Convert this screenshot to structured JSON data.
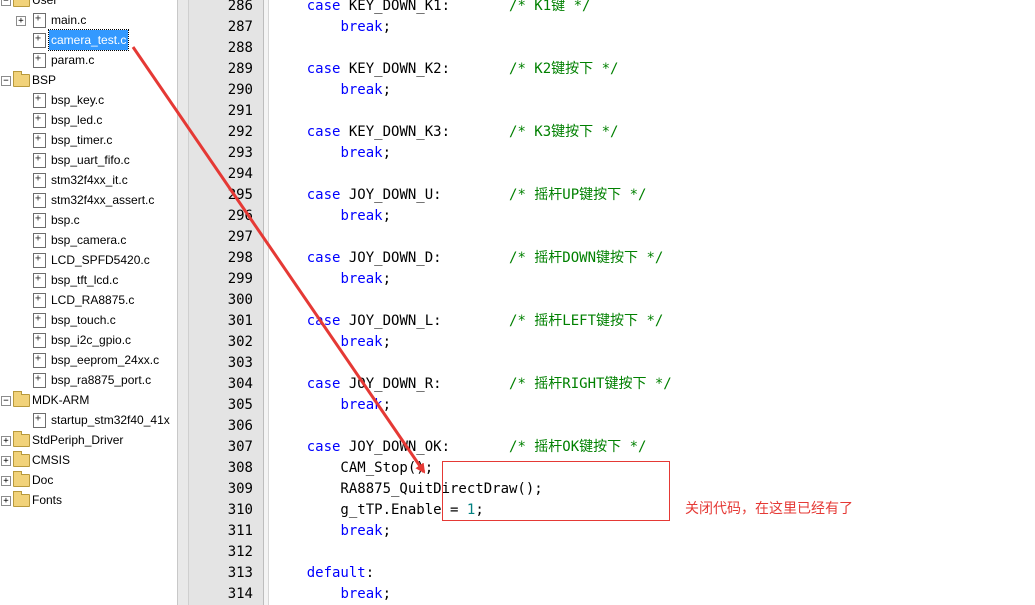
{
  "tree": {
    "items": [
      {
        "label": "User",
        "type": "folder",
        "depth": 0,
        "expander": "-"
      },
      {
        "label": "main.c",
        "type": "file",
        "depth": 1,
        "expander": "+"
      },
      {
        "label": "camera_test.c",
        "type": "file",
        "depth": 1,
        "expander": "",
        "selected": true
      },
      {
        "label": "param.c",
        "type": "file",
        "depth": 1,
        "expander": ""
      },
      {
        "label": "BSP",
        "type": "folder",
        "depth": 0,
        "expander": "-"
      },
      {
        "label": "bsp_key.c",
        "type": "file",
        "depth": 1,
        "expander": ""
      },
      {
        "label": "bsp_led.c",
        "type": "file",
        "depth": 1,
        "expander": ""
      },
      {
        "label": "bsp_timer.c",
        "type": "file",
        "depth": 1,
        "expander": ""
      },
      {
        "label": "bsp_uart_fifo.c",
        "type": "file",
        "depth": 1,
        "expander": ""
      },
      {
        "label": "stm32f4xx_it.c",
        "type": "file",
        "depth": 1,
        "expander": ""
      },
      {
        "label": "stm32f4xx_assert.c",
        "type": "file",
        "depth": 1,
        "expander": ""
      },
      {
        "label": "bsp.c",
        "type": "file",
        "depth": 1,
        "expander": ""
      },
      {
        "label": "bsp_camera.c",
        "type": "file",
        "depth": 1,
        "expander": ""
      },
      {
        "label": "LCD_SPFD5420.c",
        "type": "file",
        "depth": 1,
        "expander": ""
      },
      {
        "label": "bsp_tft_lcd.c",
        "type": "file",
        "depth": 1,
        "expander": ""
      },
      {
        "label": "LCD_RA8875.c",
        "type": "file",
        "depth": 1,
        "expander": ""
      },
      {
        "label": "bsp_touch.c",
        "type": "file",
        "depth": 1,
        "expander": ""
      },
      {
        "label": "bsp_i2c_gpio.c",
        "type": "file",
        "depth": 1,
        "expander": ""
      },
      {
        "label": "bsp_eeprom_24xx.c",
        "type": "file",
        "depth": 1,
        "expander": ""
      },
      {
        "label": "bsp_ra8875_port.c",
        "type": "file",
        "depth": 1,
        "expander": ""
      },
      {
        "label": "MDK-ARM",
        "type": "folder",
        "depth": 0,
        "expander": "-"
      },
      {
        "label": "startup_stm32f40_41x",
        "type": "file",
        "depth": 1,
        "expander": ""
      },
      {
        "label": "StdPeriph_Driver",
        "type": "folder",
        "depth": 0,
        "expander": "+"
      },
      {
        "label": "CMSIS",
        "type": "folder",
        "depth": 0,
        "expander": "+"
      },
      {
        "label": "Doc",
        "type": "folder",
        "depth": 0,
        "expander": "+"
      },
      {
        "label": "Fonts",
        "type": "folder",
        "depth": 0,
        "expander": "+"
      }
    ]
  },
  "editor": {
    "lines": [
      {
        "n": "286",
        "parts": [
          {
            "t": "    "
          },
          {
            "t": "case",
            "c": "kw"
          },
          {
            "t": " KEY_DOWN_K1:       "
          },
          {
            "t": "/* K1键 */",
            "c": "cm"
          }
        ]
      },
      {
        "n": "287",
        "parts": [
          {
            "t": "        "
          },
          {
            "t": "break",
            "c": "kw"
          },
          {
            "t": ";"
          }
        ]
      },
      {
        "n": "288",
        "parts": []
      },
      {
        "n": "289",
        "parts": [
          {
            "t": "    "
          },
          {
            "t": "case",
            "c": "kw"
          },
          {
            "t": " KEY_DOWN_K2:       "
          },
          {
            "t": "/* K2键按下 */",
            "c": "cm"
          }
        ]
      },
      {
        "n": "290",
        "parts": [
          {
            "t": "        "
          },
          {
            "t": "break",
            "c": "kw"
          },
          {
            "t": ";"
          }
        ]
      },
      {
        "n": "291",
        "parts": []
      },
      {
        "n": "292",
        "parts": [
          {
            "t": "    "
          },
          {
            "t": "case",
            "c": "kw"
          },
          {
            "t": " KEY_DOWN_K3:       "
          },
          {
            "t": "/* K3键按下 */",
            "c": "cm"
          }
        ]
      },
      {
        "n": "293",
        "parts": [
          {
            "t": "        "
          },
          {
            "t": "break",
            "c": "kw"
          },
          {
            "t": ";"
          }
        ]
      },
      {
        "n": "294",
        "parts": []
      },
      {
        "n": "295",
        "parts": [
          {
            "t": "    "
          },
          {
            "t": "case",
            "c": "kw"
          },
          {
            "t": " JOY_DOWN_U:        "
          },
          {
            "t": "/* 摇杆UP键按下 */",
            "c": "cm"
          }
        ]
      },
      {
        "n": "296",
        "parts": [
          {
            "t": "        "
          },
          {
            "t": "break",
            "c": "kw"
          },
          {
            "t": ";"
          }
        ]
      },
      {
        "n": "297",
        "parts": []
      },
      {
        "n": "298",
        "parts": [
          {
            "t": "    "
          },
          {
            "t": "case",
            "c": "kw"
          },
          {
            "t": " JOY_DOWN_D:        "
          },
          {
            "t": "/* 摇杆DOWN键按下 */",
            "c": "cm"
          }
        ]
      },
      {
        "n": "299",
        "parts": [
          {
            "t": "        "
          },
          {
            "t": "break",
            "c": "kw"
          },
          {
            "t": ";"
          }
        ]
      },
      {
        "n": "300",
        "parts": []
      },
      {
        "n": "301",
        "parts": [
          {
            "t": "    "
          },
          {
            "t": "case",
            "c": "kw"
          },
          {
            "t": " JOY_DOWN_L:        "
          },
          {
            "t": "/* 摇杆LEFT键按下 */",
            "c": "cm"
          }
        ]
      },
      {
        "n": "302",
        "parts": [
          {
            "t": "        "
          },
          {
            "t": "break",
            "c": "kw"
          },
          {
            "t": ";"
          }
        ]
      },
      {
        "n": "303",
        "parts": []
      },
      {
        "n": "304",
        "parts": [
          {
            "t": "    "
          },
          {
            "t": "case",
            "c": "kw"
          },
          {
            "t": " JOY_DOWN_R:        "
          },
          {
            "t": "/* 摇杆RIGHT键按下 */",
            "c": "cm"
          }
        ]
      },
      {
        "n": "305",
        "parts": [
          {
            "t": "        "
          },
          {
            "t": "break",
            "c": "kw"
          },
          {
            "t": ";"
          }
        ]
      },
      {
        "n": "306",
        "parts": []
      },
      {
        "n": "307",
        "parts": [
          {
            "t": "    "
          },
          {
            "t": "case",
            "c": "kw"
          },
          {
            "t": " JOY_DOWN_OK:       "
          },
          {
            "t": "/* 摇杆OK键按下 */",
            "c": "cm"
          }
        ]
      },
      {
        "n": "308",
        "parts": [
          {
            "t": "        CAM_Stop();"
          }
        ]
      },
      {
        "n": "309",
        "parts": [
          {
            "t": "        RA8875_QuitDirectDraw();"
          }
        ]
      },
      {
        "n": "310",
        "parts": [
          {
            "t": "        g_tTP.Enable = "
          },
          {
            "t": "1",
            "c": "num"
          },
          {
            "t": ";"
          }
        ]
      },
      {
        "n": "311",
        "parts": [
          {
            "t": "        "
          },
          {
            "t": "break",
            "c": "kw"
          },
          {
            "t": ";"
          }
        ]
      },
      {
        "n": "312",
        "parts": []
      },
      {
        "n": "313",
        "parts": [
          {
            "t": "    "
          },
          {
            "t": "default",
            "c": "kw"
          },
          {
            "t": ":"
          }
        ]
      },
      {
        "n": "314",
        "parts": [
          {
            "t": "        "
          },
          {
            "t": "break",
            "c": "kw"
          },
          {
            "t": ";"
          }
        ]
      }
    ]
  },
  "annotation": {
    "note": "关闭代码，在这里已经有了",
    "color": "#e53935"
  }
}
